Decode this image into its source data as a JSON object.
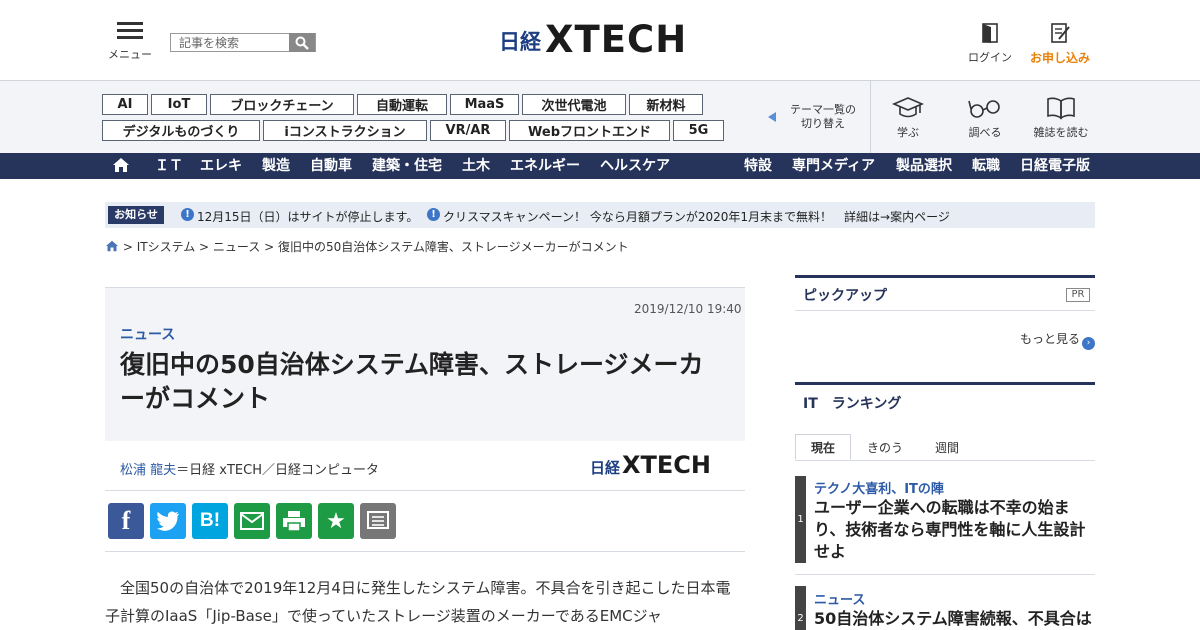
{
  "header": {
    "menu_label": "メニュー",
    "search_placeholder": "記事を検索",
    "logo_nikkei": "日経",
    "logo_xtech": "XTECH",
    "login_label": "ログイン",
    "signup_label": "お申し込み",
    "signup_color": "#e8820c"
  },
  "themes": {
    "row1": [
      "AI",
      "IoT",
      "ブロックチェーン",
      "自動運転",
      "MaaS",
      "次世代電池",
      "新材料"
    ],
    "row2": [
      "デジタルものづくり",
      "iコンストラクション",
      "VR/AR",
      "Webフロントエンド",
      "5G"
    ],
    "switch_line1": "テーマ一覧の",
    "switch_line2": "切り替え"
  },
  "tools": {
    "learn": "学ぶ",
    "research": "調べる",
    "magazine": "雑誌を読む"
  },
  "nav": {
    "left": [
      "ＩＴ",
      "エレキ",
      "製造",
      "自動車",
      "建築・住宅",
      "土木",
      "エネルギー",
      "ヘルスケア"
    ],
    "right": [
      "特設",
      "専門メディア",
      "製品選択",
      "転職",
      "日経電子版"
    ],
    "bar_color": "#26335a"
  },
  "notice": {
    "badge": "お知らせ",
    "item1": "12月15日（日）はサイトが停止します。",
    "item2": "クリスマスキャンペーン！ 今なら月額プランが2020年1月末まで無料！　詳細は→案内ページ"
  },
  "breadcrumb": {
    "text": "> ITシステム > ニュース > 復旧中の50自治体システム障害、ストレージメーカーがコメント"
  },
  "article": {
    "date": "2019/12/10 19:40",
    "category": "ニュース",
    "title": "復旧中の50自治体システム障害、ストレージメーカーがコメント",
    "author_name": "松浦 龍夫",
    "author_affil": "＝日経 xTECH／日経コンピュータ",
    "logo_nikkei": "日経",
    "logo_xtech": "XTECH",
    "body": "全国50の自治体で2019年12月4日に発生したシステム障害。不具合を引き起こした日本電子計算のIaaS「Jip-Base」で使っていたストレージ装置のメーカーであるEMCジャ"
  },
  "share": {
    "facebook": "f",
    "twitter": "t",
    "hatena": "B!",
    "mail": "mail",
    "print": "print",
    "clip": "★",
    "memo": "memo"
  },
  "sidebar": {
    "pickup_title": "ピックアップ",
    "pr": "PR",
    "more": "もっと見る",
    "ranking_title": "IT　ランキング",
    "tabs": [
      "現在",
      "きのう",
      "週間"
    ],
    "ranking": [
      {
        "num": "1",
        "category": "テクノ大喜利、ITの陣",
        "title": "ユーザー企業への転職は不幸の始まり、技術者なら専門性を軸に人生設計せよ"
      },
      {
        "num": "2",
        "category": "ニュース",
        "title": "50自治体システム障害続報、不具合は"
      }
    ]
  }
}
